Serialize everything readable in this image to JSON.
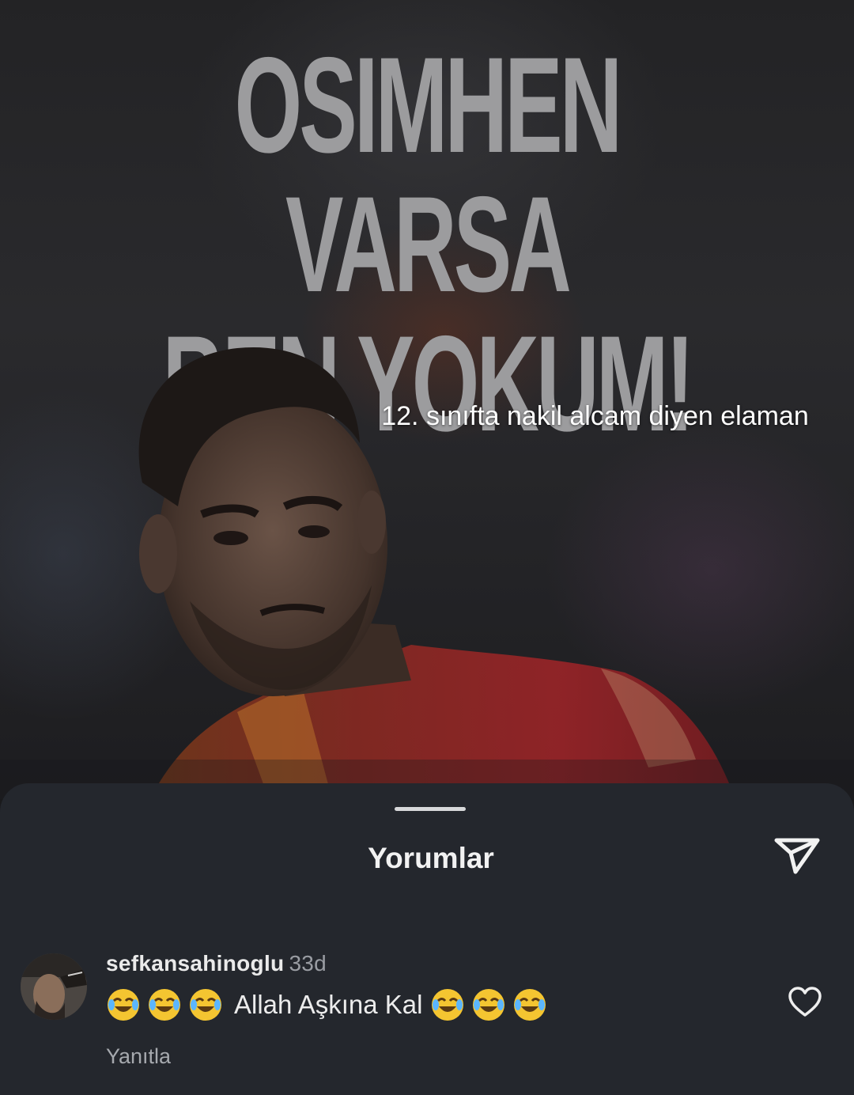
{
  "video": {
    "headline_line1": "OSIMHEN VARSA",
    "headline_line2": "BEN YOKUM!",
    "caption": "12. sınıfta nakil alcam diyen elaman"
  },
  "comments_sheet": {
    "title": "Yorumlar",
    "share_icon": "send-icon",
    "comment": {
      "username": "sefkansahinoglu",
      "time": "33d",
      "emoji_before": 3,
      "emoji_after": 3,
      "emoji_name": "face-with-tears-of-joy",
      "text": "Allah Aşkına Kal",
      "reply_label": "Yanıtla",
      "like_icon": "heart-icon"
    }
  },
  "colors": {
    "sheet_bg": "#24272d",
    "headline": "#9c9c9e",
    "jersey_red": "#b4252a",
    "jersey_orange": "#e08a2a"
  }
}
